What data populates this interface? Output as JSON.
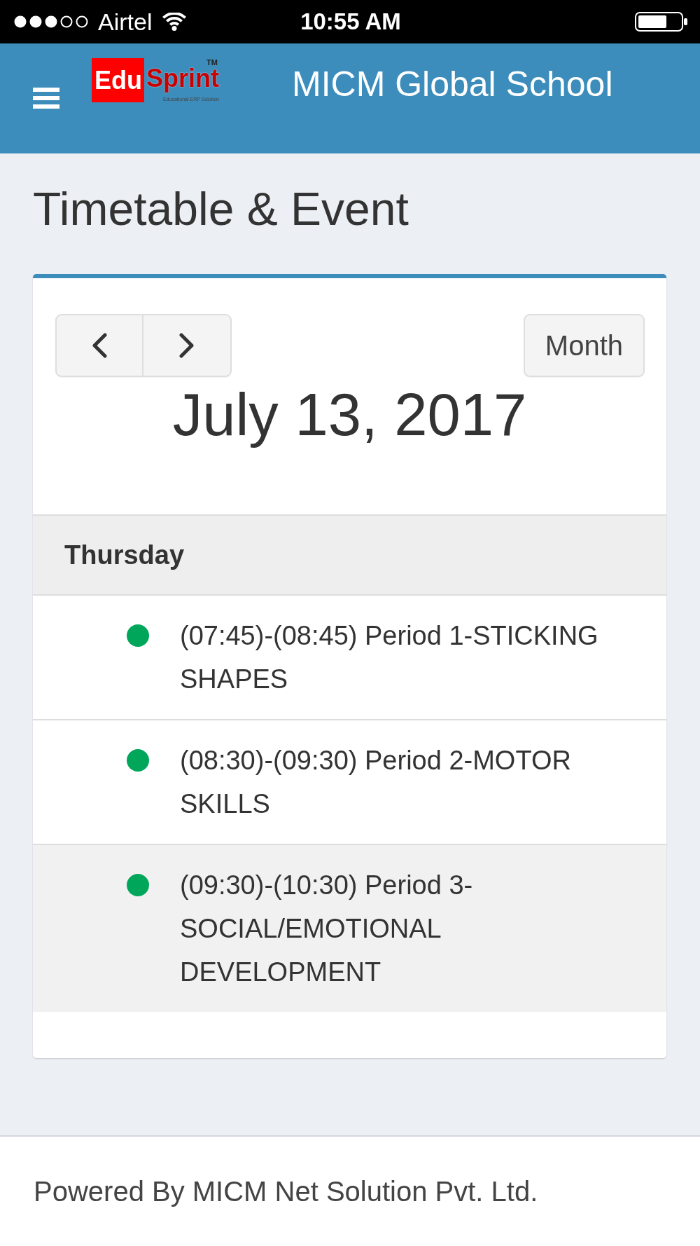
{
  "status_bar": {
    "carrier": "Airtel",
    "time": "10:55 AM"
  },
  "header": {
    "logo": {
      "badge": "Edu",
      "word": "Sprint",
      "trademark": "TM",
      "tagline": "Educational ERP Solution"
    },
    "title": "MICM Global School"
  },
  "page_title": "Timetable & Event",
  "calendar": {
    "view_button": "Month",
    "date_title": "July 13, 2017",
    "day": "Thursday",
    "events": [
      {
        "text": "(07:45)-(08:45) Period 1-STICKING SHAPES",
        "color": "#00a65a",
        "highlighted": false
      },
      {
        "text": "(08:30)-(09:30) Period 2-MOTOR SKILLS",
        "color": "#00a65a",
        "highlighted": false
      },
      {
        "text": "(09:30)-(10:30) Period 3-SOCIAL/EMOTIONAL DEVELOPMENT",
        "color": "#00a65a",
        "highlighted": true
      }
    ]
  },
  "footer": "Powered By MICM Net Solution Pvt. Ltd."
}
